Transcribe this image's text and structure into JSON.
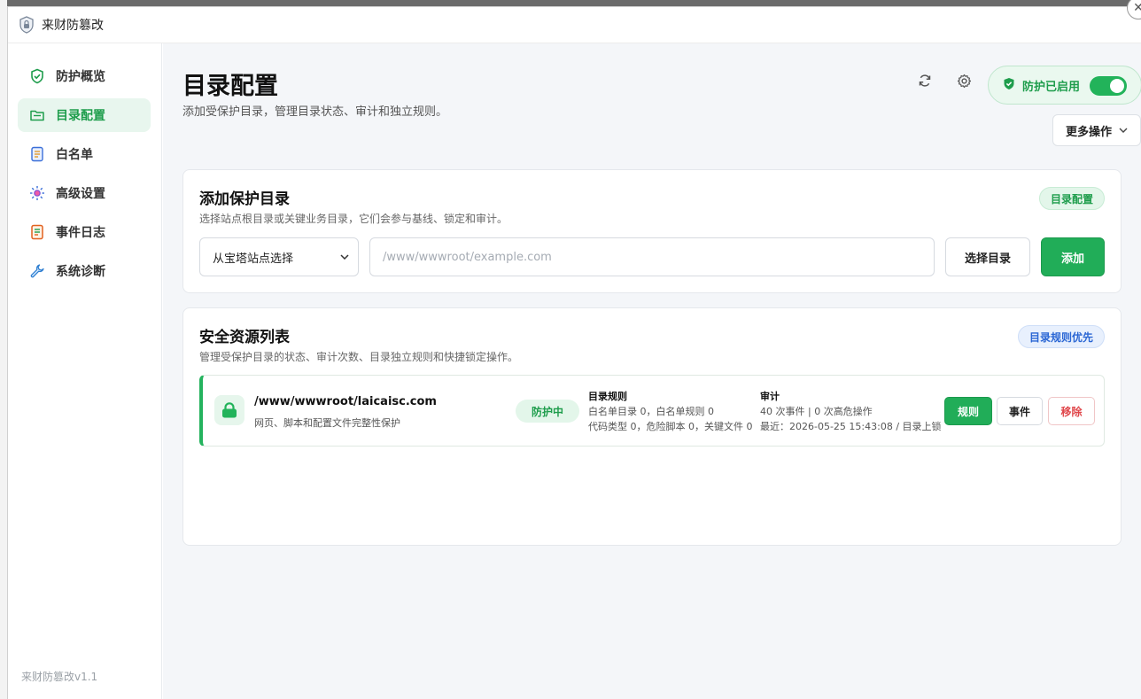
{
  "window": {
    "title": "来财防篡改"
  },
  "sidebar": {
    "items": [
      {
        "label": "防护概览",
        "icon": "shield-check-icon"
      },
      {
        "label": "目录配置",
        "icon": "folder-icon",
        "active": true
      },
      {
        "label": "白名单",
        "icon": "document-list-icon"
      },
      {
        "label": "高级设置",
        "icon": "sun-gear-icon"
      },
      {
        "label": "事件日志",
        "icon": "log-icon"
      },
      {
        "label": "系统诊断",
        "icon": "wrench-icon"
      }
    ],
    "version": "来财防篡改v1.1"
  },
  "header": {
    "title": "目录配置",
    "subtitle": "添加受保护目录，管理目录状态、审计和独立规则。",
    "protection_label": "防护已启用",
    "protection_enabled": true,
    "more_label": "更多操作"
  },
  "add_card": {
    "title": "添加保护目录",
    "desc": "选择站点根目录或关键业务目录，它们会参与基线、锁定和审计。",
    "tag": "目录配置",
    "select_value": "从宝塔站点选择",
    "path_placeholder": "/www/wwwroot/example.com",
    "choose_label": "选择目录",
    "add_label": "添加"
  },
  "list_card": {
    "title": "安全资源列表",
    "desc": "管理受保护目录的状态、审计次数、目录独立规则和快捷锁定操作。",
    "tag": "目录规则优先",
    "rows": [
      {
        "path": "/www/wwwroot/laicaisc.com",
        "desc": "网页、脚本和配置文件完整性保护",
        "status": "防护中",
        "rules_title": "目录规则",
        "rules_line1": "白名单目录 0，白名单规则 0",
        "rules_line2": "代码类型 0，危险脚本 0，关键文件 0",
        "audit_title": "审计",
        "audit_line1": "40 次事件 | 0 次高危操作",
        "audit_line2": "最近：2026-05-25 15:43:08 / 目录上锁",
        "btn_rule": "规则",
        "btn_event": "事件",
        "btn_remove": "移除"
      }
    ]
  },
  "colors": {
    "accent": "#21ad58",
    "accent_light": "#e3f6ea",
    "danger": "#e0474b",
    "info": "#2a66d4"
  }
}
